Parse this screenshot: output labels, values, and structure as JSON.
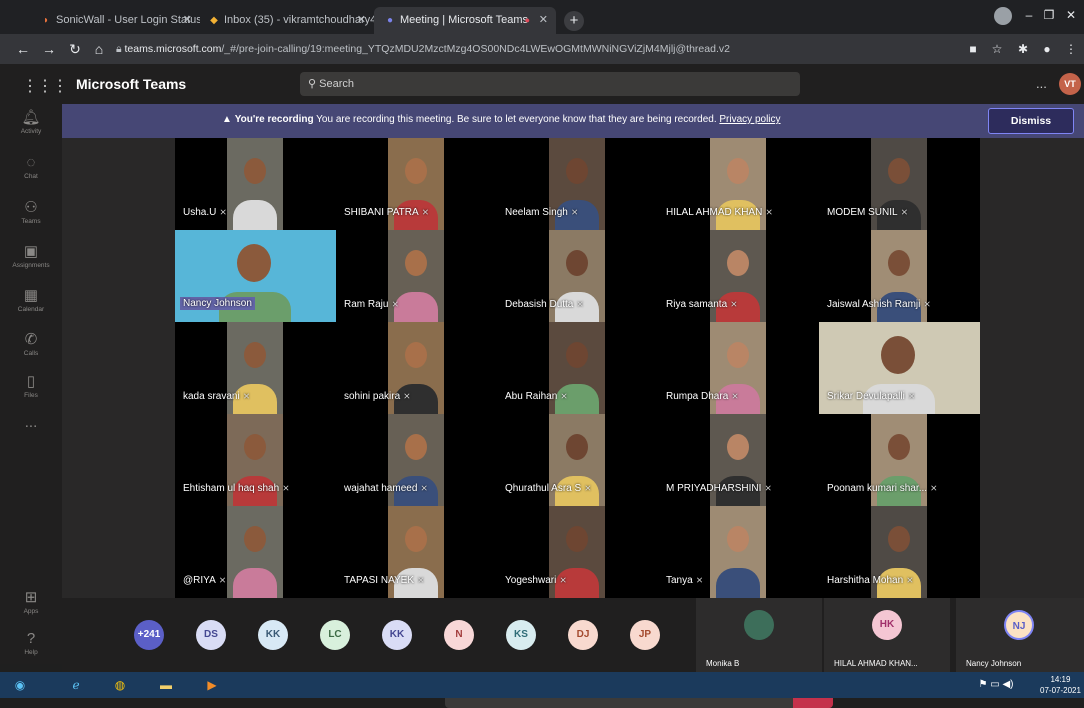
{
  "browser": {
    "tabs": [
      {
        "title": "SonicWall - User Login Status"
      },
      {
        "title": "Inbox (35) - vikramtchoudhary4..."
      },
      {
        "title": "Meeting | Microsoft Teams"
      }
    ],
    "url_host": "teams.microsoft.com",
    "url_path": "/_#/pre-join-calling/19:meeting_YTQzMDU2MzctMzg4OS00NDc4LWEwOGMtMWNiNGViZjM4Mjlj@thread.v2"
  },
  "teams": {
    "app_name": "Microsoft Teams",
    "search_placeholder": "Search",
    "me_initials": "VT",
    "more": "..."
  },
  "rail": [
    {
      "label": "Activity",
      "icon": "bell-icon"
    },
    {
      "label": "Chat",
      "icon": "chat-icon"
    },
    {
      "label": "Teams",
      "icon": "teams-icon"
    },
    {
      "label": "Assignments",
      "icon": "assignments-icon"
    },
    {
      "label": "Calendar",
      "icon": "calendar-icon"
    },
    {
      "label": "Calls",
      "icon": "phone-icon"
    },
    {
      "label": "Files",
      "icon": "files-icon"
    },
    {
      "label": "...",
      "icon": "more-icon"
    },
    {
      "label": "Apps",
      "icon": "apps-icon"
    },
    {
      "label": "Help",
      "icon": "help-icon"
    }
  ],
  "banner": {
    "bold": "You're recording",
    "text": "You are recording this meeting. Be sure to let everyone know that they are being recorded.",
    "link": "Privacy policy",
    "dismiss": "Dismiss"
  },
  "participants": [
    "Usha.U",
    "SHIBANI PATRA",
    "Neelam Singh",
    "HILAL AHMAD KHAN",
    "MODEM SUNIL",
    "Nancy Johnson",
    "Ram Raju",
    "Debasish Dutta",
    "Riya samanta",
    "Jaiswal Ashish Ramji",
    "kada sravani",
    "sohini pakira",
    "Abu Raihan",
    "Rumpa Dhara",
    "Srikar Devulapalli",
    "Ehtisham ul haq shah",
    "wajahat hameed",
    "Qhurathul Asra S",
    "M PRIYADHARSHINI",
    "Poonam kumari shar...",
    "@RIYA",
    "TAPASI NAYEK",
    "Yogeshwari",
    "Tanya",
    "Harshitha Mohan"
  ],
  "strip": {
    "overflow": "+241",
    "chips": [
      {
        "initials": "DS",
        "bg": "#d9dcf5",
        "fg": "#444791"
      },
      {
        "initials": "KK",
        "bg": "#d8e9f5",
        "fg": "#3a5a75"
      },
      {
        "initials": "LC",
        "bg": "#d8f0dc",
        "fg": "#3d6b45"
      },
      {
        "initials": "KK",
        "bg": "#d9dcf5",
        "fg": "#444791"
      },
      {
        "initials": "N",
        "bg": "#f8d7d7",
        "fg": "#a33d3d"
      },
      {
        "initials": "KS",
        "bg": "#d8ecef",
        "fg": "#2f6c77"
      },
      {
        "initials": "DJ",
        "bg": "#f8d9cf",
        "fg": "#a44a2e"
      },
      {
        "initials": "JP",
        "bg": "#f8d9cf",
        "fg": "#a44a2e"
      }
    ],
    "tiles": [
      {
        "name": "Monika B"
      },
      {
        "name": "HILAL AHMAD KHAN...",
        "initials": "HK"
      },
      {
        "name": "Nancy Johnson",
        "initials": "NJ"
      }
    ]
  },
  "taskbar": {
    "time": "14:19",
    "date": "07-07-2021"
  },
  "colors": {
    "accent": "#6264a7",
    "banner": "#464775",
    "hangup": "#c4314b"
  }
}
